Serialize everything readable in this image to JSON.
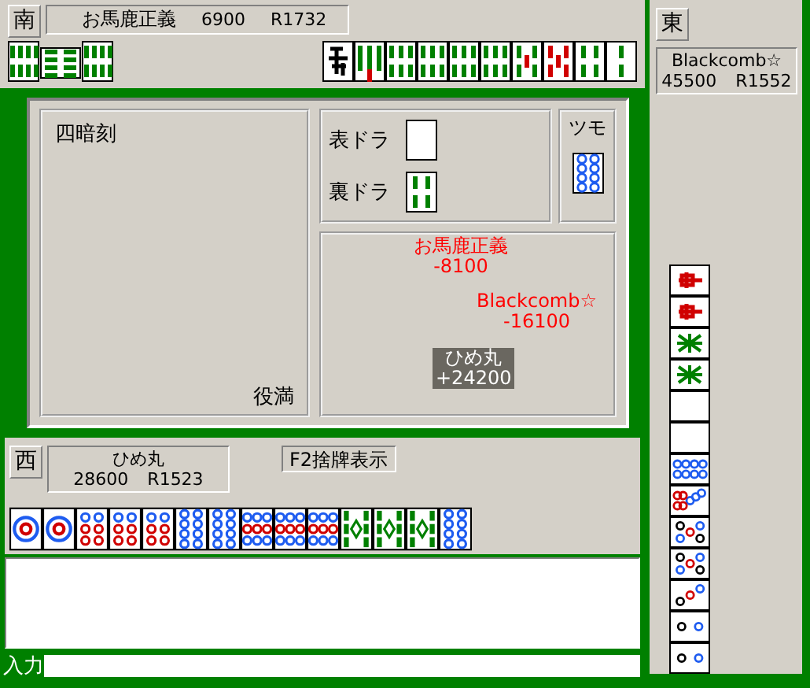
{
  "top_player": {
    "wind": "南",
    "name": "お馬鹿正義",
    "score": "6900",
    "rating": "R1732",
    "melds": [
      {
        "kind": "sou8",
        "rotated": false
      },
      {
        "kind": "sou8",
        "rotated": true
      },
      {
        "kind": "sou8",
        "rotated": false
      }
    ],
    "hand": [
      {
        "kind": "char"
      },
      {
        "kind": "sou7"
      },
      {
        "kind": "sou6"
      },
      {
        "kind": "sou6"
      },
      {
        "kind": "sou6"
      },
      {
        "kind": "sou6"
      },
      {
        "kind": "sou5"
      },
      {
        "kind": "sou5red"
      },
      {
        "kind": "sou4"
      },
      {
        "kind": "sou2"
      }
    ]
  },
  "result": {
    "yaku": [
      "四暗刻"
    ],
    "limit": "役満",
    "omote_dora": {
      "label": "表ドラ",
      "tile": {
        "kind": "blank"
      }
    },
    "ura_dora": {
      "label": "裏ドラ",
      "tile": {
        "kind": "sou4"
      }
    },
    "tsumo": {
      "label": "ツモ",
      "tile": {
        "kind": "pin8"
      }
    },
    "payments": [
      {
        "name": "お馬鹿正義",
        "amount": "-8100",
        "color": "#ff0000"
      },
      {
        "name": "Blackcomb☆",
        "amount": "-16100",
        "color": "#ff0000"
      },
      {
        "name": "ひめ丸",
        "amount": "+24200",
        "color": "#ffffff"
      }
    ]
  },
  "bottom_player": {
    "wind": "西",
    "name": "ひめ丸",
    "score": "28600",
    "rating": "R1523",
    "discard_button": "F2捨牌表示",
    "hand": [
      {
        "kind": "pin1"
      },
      {
        "kind": "pin1"
      },
      {
        "kind": "pin6"
      },
      {
        "kind": "pin6"
      },
      {
        "kind": "pin6"
      },
      {
        "kind": "pin8"
      },
      {
        "kind": "pin8"
      },
      {
        "kind": "pin9"
      },
      {
        "kind": "pin9"
      },
      {
        "kind": "pin9"
      },
      {
        "kind": "sou9"
      },
      {
        "kind": "sou9"
      },
      {
        "kind": "sou9"
      },
      {
        "kind": "pin8"
      }
    ]
  },
  "right_player": {
    "wind": "東",
    "name": "Blackcomb☆",
    "score": "45500",
    "rating": "R1552",
    "discards": [
      {
        "kind": "chun"
      },
      {
        "kind": "chun"
      },
      {
        "kind": "hatsu"
      },
      {
        "kind": "hatsu"
      },
      {
        "kind": "blank"
      },
      {
        "kind": "blank"
      },
      {
        "kind": "pin8"
      },
      {
        "kind": "pin7"
      },
      {
        "kind": "pin5"
      },
      {
        "kind": "pin5"
      },
      {
        "kind": "pin3"
      },
      {
        "kind": "pin2"
      },
      {
        "kind": "pin2"
      }
    ]
  },
  "chat": {
    "input_label": "入力"
  }
}
